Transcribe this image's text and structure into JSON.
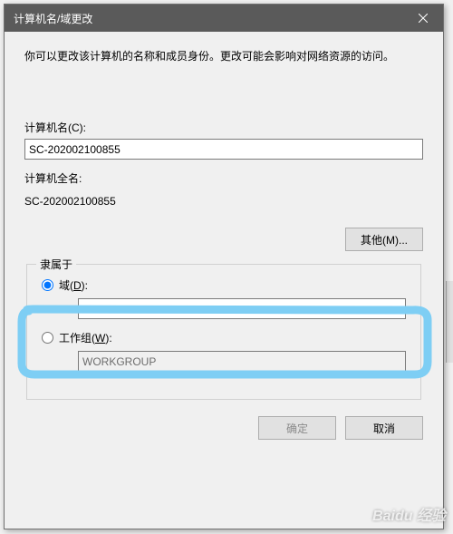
{
  "window": {
    "title": "计算机名/域更改"
  },
  "description": "你可以更改该计算机的名称和成员身份。更改可能会影响对网络资源的访问。",
  "computerName": {
    "label": "计算机名(C):",
    "value": "SC-202002100855"
  },
  "fullName": {
    "label": "计算机全名:",
    "value": "SC-202002100855"
  },
  "buttons": {
    "other": "其他(M)...",
    "ok": "确定",
    "cancel": "取消"
  },
  "memberOf": {
    "title": "隶属于",
    "domain": {
      "label": "域(D):",
      "value": "",
      "selected": true
    },
    "workgroup": {
      "label": "工作组(W):",
      "value": "WORKGROUP",
      "selected": false
    }
  },
  "watermark": "Baidu 经验"
}
